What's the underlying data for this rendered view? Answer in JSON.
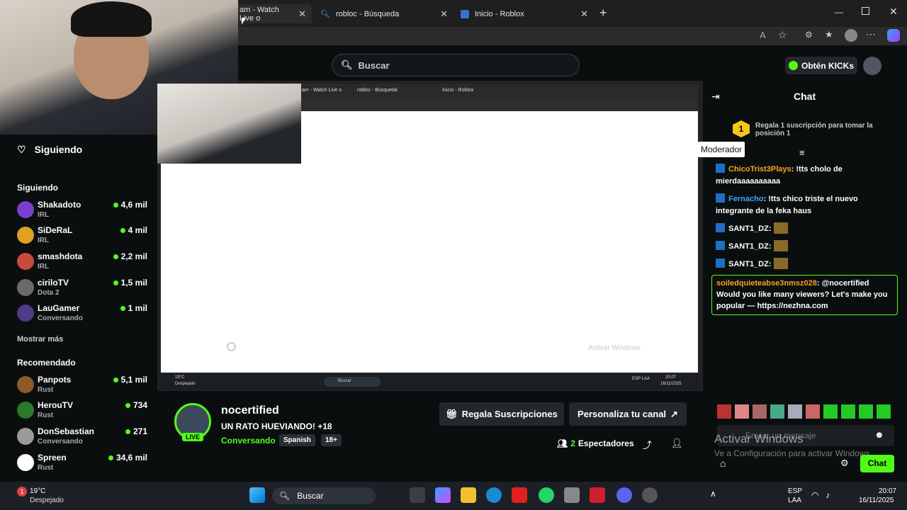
{
  "browser": {
    "tabs": [
      {
        "title": "am - Watch Live o",
        "close": "✕"
      },
      {
        "title": "robloc - Búsqueda",
        "close": "✕"
      },
      {
        "title": "Inicio - Roblox",
        "close": "✕"
      }
    ],
    "new_tab": "+"
  },
  "header": {
    "search_placeholder": "Buscar",
    "kicks_label": "Obtén KICKs"
  },
  "sidebar": {
    "following_title": "Siguiendo",
    "following_header": "Siguiendo",
    "show_more": "Mostrar más",
    "recommended_header": "Recomendado",
    "following": [
      {
        "name": "Shakadoto",
        "category": "IRL",
        "viewers": "4,6 mil",
        "color": "#7a3fd0"
      },
      {
        "name": "SiDeRaL",
        "category": "IRL",
        "viewers": "4 mil",
        "color": "#e0a020"
      },
      {
        "name": "smashdota",
        "category": "IRL",
        "viewers": "2,2 mil",
        "color": "#c84a3a"
      },
      {
        "name": "ciriloTV",
        "category": "Dota 2",
        "viewers": "1,5 mil",
        "color": "#6a6a6a"
      },
      {
        "name": "LauGamer",
        "category": "Conversando",
        "viewers": "1 mil",
        "color": "#503a8a"
      }
    ],
    "recommended": [
      {
        "name": "Panpots",
        "category": "Rust",
        "viewers": "5,1 mil",
        "color": "#8a5a2a"
      },
      {
        "name": "HerouTV",
        "category": "Rust",
        "viewers": "734",
        "color": "#2a7a2a"
      },
      {
        "name": "DonSebastian",
        "category": "Conversando",
        "viewers": "271",
        "color": "#9a9a9a"
      },
      {
        "name": "Spreen",
        "category": "Rust",
        "viewers": "34,6 mil",
        "color": "#ffffff"
      }
    ]
  },
  "inner_browser": {
    "tabs": [
      "am - Watch Live o",
      "robloc - Búsqueda",
      "Inicio - Roblox"
    ],
    "watermark": "Activar Windows",
    "taskbar_search": "Buscar",
    "weather": "19°C",
    "weather_desc": "Despejado",
    "lang": "ESP LAA",
    "time": "20:07",
    "date": "16/11/2025"
  },
  "stream": {
    "channel": "nocertified",
    "title": "UN RATO HUEVIANDO! +18",
    "category": "Conversando",
    "language": "Spanish",
    "rating": "18+",
    "live_badge": "LIVE",
    "gift_button": "Regala Suscripciones",
    "customize_button": "Personaliza tu canal",
    "viewers_count": "2",
    "viewers_label": "Espectadores"
  },
  "chat": {
    "title": "Chat",
    "gift_prompt": "Regala 1 suscripción para tomar la posición 1",
    "gift_rank": "1",
    "tooltip": "Moderador",
    "messages": [
      {
        "user": "ChicoTrist3Plays",
        "color": "#f5a623",
        "text": "!tts cholo de mierdaaaaaaaaaa"
      },
      {
        "user": "Fernacho",
        "color": "#3ea6ff",
        "text": "!tts chico triste el nuevo integrante de la feka haus"
      },
      {
        "user": "SANT1_DZ",
        "color": "#ffffff",
        "text": ""
      },
      {
        "user": "SANT1_DZ",
        "color": "#ffffff",
        "text": ""
      },
      {
        "user": "SANT1_DZ",
        "color": "#ffffff",
        "text": ""
      }
    ],
    "highlight": {
      "user": "soiledquieteabse3nmsz028",
      "text": ": @nocertified Would you like many viewers? Let's make you popular — https://nezhna.com"
    },
    "input_placeholder": "Enviar un mensaje",
    "send_label": "Chat",
    "activate_title": "Activar Windows",
    "activate_sub": "Ve a Configuración para activar Windows."
  },
  "webcam": {},
  "taskbar": {
    "weather": "19°C",
    "weather_desc": "Despejado",
    "search": "Buscar",
    "lang1": "ESP",
    "lang2": "LAA",
    "time": "20:07",
    "date": "16/11/2025",
    "notif_badge": "1"
  }
}
